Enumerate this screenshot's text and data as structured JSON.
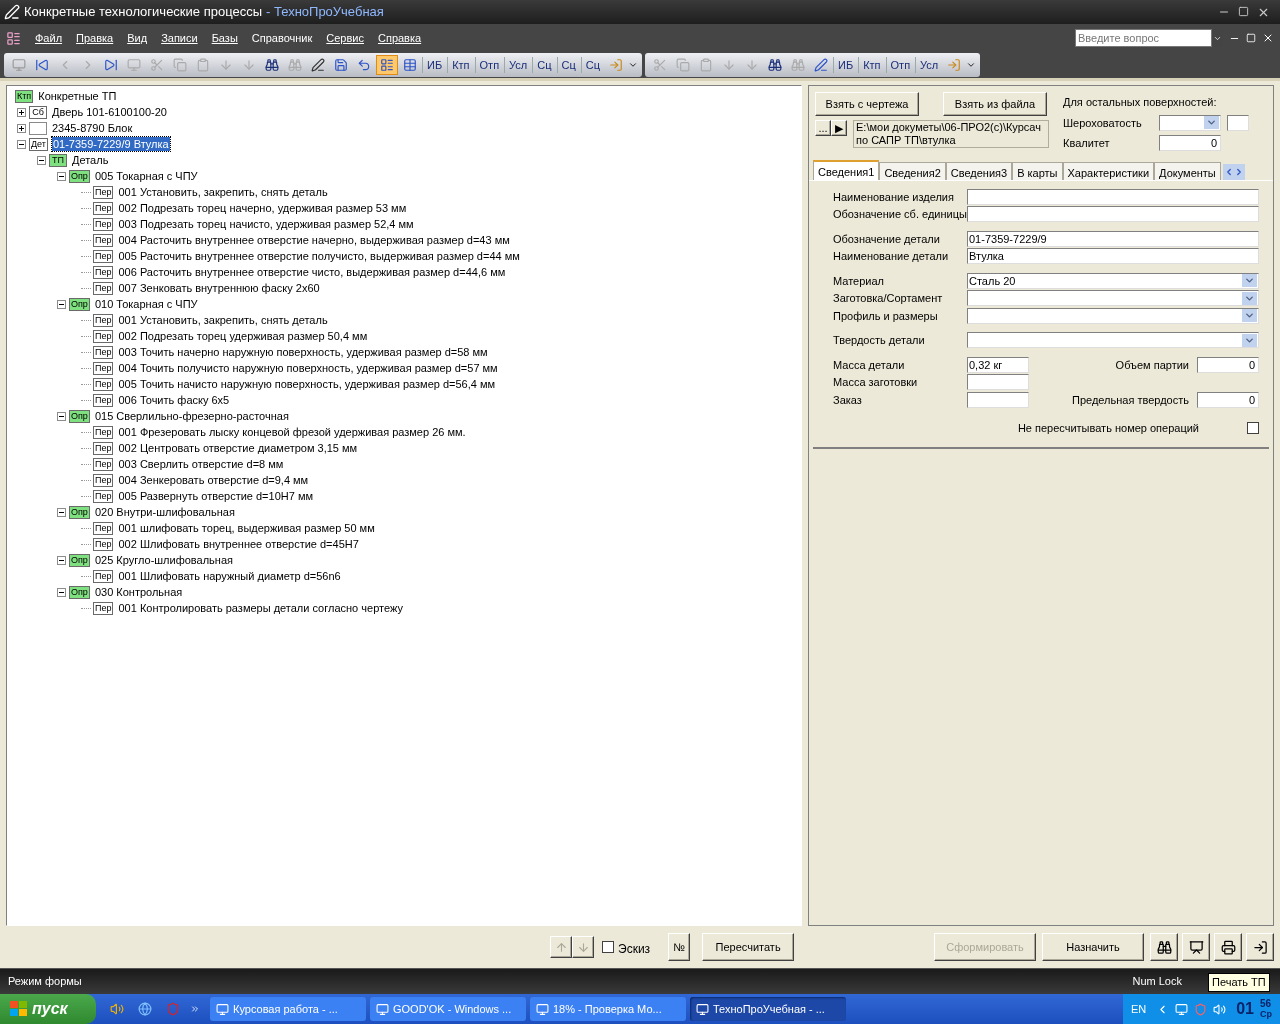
{
  "window": {
    "title": "Конкретные технологические процессы",
    "app_name": "- ТехноПроУчебная"
  },
  "menu": [
    {
      "label": "Файл",
      "underlined": true
    },
    {
      "label": "Правка",
      "underlined": true
    },
    {
      "label": "Вид",
      "underlined": true
    },
    {
      "label": "Записи",
      "underlined": true
    },
    {
      "label": "Базы",
      "underlined": true
    },
    {
      "label": "Справочник",
      "underlined": false
    },
    {
      "label": "Сервис",
      "underlined": true
    },
    {
      "label": "Справка",
      "underlined": true
    }
  ],
  "help_search": {
    "placeholder": "Введите вопрос"
  },
  "toolbar_main": {
    "view_buttons": [
      {
        "selected": true
      },
      {
        "selected": false
      }
    ],
    "text_buttons": [
      "ИБ",
      "Ктп",
      "Отп",
      "Усл",
      "Сц",
      "Сц",
      "Сц"
    ]
  },
  "toolbar_edit": {
    "text_buttons": [
      "ИБ",
      "Ктп",
      "Отп",
      "Усл"
    ]
  },
  "tree": [
    {
      "badge": "Ктп",
      "kind": "green",
      "label": "Конкретные ТП",
      "children": [
        {
          "badge": "Сб",
          "kind": "plain",
          "label": "Дверь 101-6100100-20",
          "expanded": false,
          "selected": false
        },
        {
          "kind": "blank",
          "label": "2345-8790 Блок",
          "expanded": false,
          "selected": false
        },
        {
          "badge": "Дет",
          "kind": "plain",
          "label": "01-7359-7229/9 Втулка",
          "expanded": true,
          "selected": true,
          "children": [
            {
              "badge": "ТП",
              "kind": "green",
              "label": "Деталь",
              "expanded": true,
              "selected": false,
              "children": [
                {
                  "badge": "Опр",
                  "kind": "green",
                  "label": "005 Токарная с ЧПУ",
                  "expanded": true,
                  "selected": false,
                  "children": [
                    {
                      "badge": "Пер",
                      "kind": "plain",
                      "label": "001 Установить, закрепить, снять деталь"
                    },
                    {
                      "badge": "Пер",
                      "kind": "plain",
                      "label": "002 Подрезать торец начерно, удерживая размер 53 мм"
                    },
                    {
                      "badge": "Пер",
                      "kind": "plain",
                      "label": "003 Подрезать торец начисто, удерживая размер 52,4 мм"
                    },
                    {
                      "badge": "Пер",
                      "kind": "plain",
                      "label": "004 Расточить внутреннее отверстие начерно, выдерживая размер d=43 мм"
                    },
                    {
                      "badge": "Пер",
                      "kind": "plain",
                      "label": "005 Расточить внутреннее отверстие получисто, выдерживая размер d=44 мм"
                    },
                    {
                      "badge": "Пер",
                      "kind": "plain",
                      "label": "006 Расточить внутреннее отверстие чисто, выдерживая размер d=44,6 мм"
                    },
                    {
                      "badge": "Пер",
                      "kind": "plain",
                      "label": "007 Зенковать внутреннюю фаску 2х60"
                    }
                  ]
                },
                {
                  "badge": "Опр",
                  "kind": "green",
                  "label": "010 Токарная с ЧПУ",
                  "expanded": true,
                  "selected": false,
                  "children": [
                    {
                      "badge": "Пер",
                      "kind": "plain",
                      "label": "001 Установить, закрепить, снять деталь"
                    },
                    {
                      "badge": "Пер",
                      "kind": "plain",
                      "label": "002 Подрезать торец  удерживая размер 50,4 мм"
                    },
                    {
                      "badge": "Пер",
                      "kind": "plain",
                      "label": "003 Точить начерно наружную поверхность, удерживая размер d=58 мм"
                    },
                    {
                      "badge": "Пер",
                      "kind": "plain",
                      "label": "004 Точить получисто наружную поверхность, удерживая размер d=57 мм"
                    },
                    {
                      "badge": "Пер",
                      "kind": "plain",
                      "label": "005 Точить начисто наружную поверхность, удерживая размер d=56,4 мм"
                    },
                    {
                      "badge": "Пер",
                      "kind": "plain",
                      "label": "006 Точить фаску 6х5"
                    }
                  ]
                },
                {
                  "badge": "Опр",
                  "kind": "green",
                  "label": "015 Сверлильно-фрезерно-расточная",
                  "expanded": true,
                  "selected": false,
                  "children": [
                    {
                      "badge": "Пер",
                      "kind": "plain",
                      "label": "001 Фрезеровать лыску концевой фрезой удерживая размер 26 мм."
                    },
                    {
                      "badge": "Пер",
                      "kind": "plain",
                      "label": "002 Центровать отверстие диаметром 3,15 мм"
                    },
                    {
                      "badge": "Пер",
                      "kind": "plain",
                      "label": "003 Сверлить отверстие d=8 мм"
                    },
                    {
                      "badge": "Пер",
                      "kind": "plain",
                      "label": "004 Зенкеровать отверстие d=9,4 мм"
                    },
                    {
                      "badge": "Пер",
                      "kind": "plain",
                      "label": "005 Развернуть отверстие d=10Н7 мм"
                    }
                  ]
                },
                {
                  "badge": "Опр",
                  "kind": "green",
                  "label": "020 Внутри-шлифовальная",
                  "expanded": true,
                  "selected": false,
                  "children": [
                    {
                      "badge": "Пер",
                      "kind": "plain",
                      "label": "001 шлифовать торец, выдерживая размер 50 мм"
                    },
                    {
                      "badge": "Пер",
                      "kind": "plain",
                      "label": "002 Шлифовать внутреннее отверстие d=45Н7"
                    }
                  ]
                },
                {
                  "badge": "Опр",
                  "kind": "green",
                  "label": "025 Кругло-шлифовальная",
                  "expanded": true,
                  "selected": false,
                  "children": [
                    {
                      "badge": "Пер",
                      "kind": "plain",
                      "label": "001 Шлифовать наружный диаметр d=56n6"
                    }
                  ]
                },
                {
                  "badge": "Опр",
                  "kind": "green",
                  "label": "030 Контрольная",
                  "expanded": true,
                  "selected": false,
                  "children": [
                    {
                      "badge": "Пер",
                      "kind": "plain",
                      "label": "001 Контролировать размеры детали согласно чертежу"
                    }
                  ]
                }
              ]
            }
          ]
        }
      ]
    }
  ],
  "source_buttons": [
    "Взять с чертежа",
    "Взять из файла"
  ],
  "path_buttons": [
    "...",
    "▶"
  ],
  "file_path": "E:\\мои докуметы\\06-ПРО2(с)\\Курсач по САПР ТП\\втулка",
  "surfaces": {
    "heading": "Для остальных поверхностей:",
    "roughness_label": "Шероховатость",
    "quality_label": "Квалитет",
    "quality_value": "0"
  },
  "tabs": [
    {
      "label": "Сведения1",
      "selected": true
    },
    {
      "label": "Сведения2",
      "selected": false
    },
    {
      "label": "Сведения3",
      "selected": false
    },
    {
      "label": "В карты",
      "selected": false
    },
    {
      "label": "Характеристики",
      "selected": false
    },
    {
      "label": "Документы",
      "selected": false
    }
  ],
  "field_groups": [
    [
      {
        "label": "Наименование изделия",
        "kind": "text"
      },
      {
        "label": "Обозначение сб. единицы",
        "kind": "text"
      }
    ],
    [
      {
        "label": "Обозначение детали",
        "kind": "text",
        "value": "01-7359-7229/9"
      },
      {
        "label": "Наименование детали",
        "kind": "text",
        "value": "Втулка"
      }
    ],
    [
      {
        "label": "Материал",
        "kind": "select",
        "value": "Сталь 20"
      },
      {
        "label": "Заготовка/Сортамент",
        "kind": "select"
      },
      {
        "label": "Профиль и размеры",
        "kind": "select"
      }
    ],
    [
      {
        "label": "Твердость детали",
        "kind": "select"
      }
    ]
  ],
  "mass_fields": [
    {
      "label": "Масса детали",
      "value": "0,32 кг"
    },
    {
      "label": "Масса заготовки"
    },
    {
      "label": "Заказ"
    }
  ],
  "right_fields": [
    {
      "label": "Объем партии",
      "value": "0"
    },
    {
      "label": "Предельная твердость",
      "value": "0"
    }
  ],
  "renumber": {
    "label": "Не пересчитывать номер операций",
    "checked": false
  },
  "move_buttons": [
    {
      "disabled": true
    },
    {
      "disabled": true
    }
  ],
  "sketch": {
    "label": "Эскиз",
    "checked": false
  },
  "number_button": "№",
  "recalc_button": "Пересчитать",
  "actions": [
    {
      "label": "Сформировать",
      "disabled": true
    },
    {
      "label": "Назначить",
      "disabled": false
    }
  ],
  "tooltip": "Печать ТП",
  "status_bar": [
    "Режим формы",
    "Num Lock"
  ],
  "taskbar": {
    "start": "пуск",
    "tasks": [
      {
        "label": "Курсовая работа - ...",
        "selected": false
      },
      {
        "label": "GOOD'OK - Windows ...",
        "selected": false
      },
      {
        "label": "18% - Проверка Мо...",
        "selected": false
      },
      {
        "label": "ТехноПроУчебная - ...",
        "selected": true
      }
    ],
    "language": "EN",
    "clock": {
      "hours": "01",
      "minutes": "56",
      "day": "Ср"
    }
  }
}
